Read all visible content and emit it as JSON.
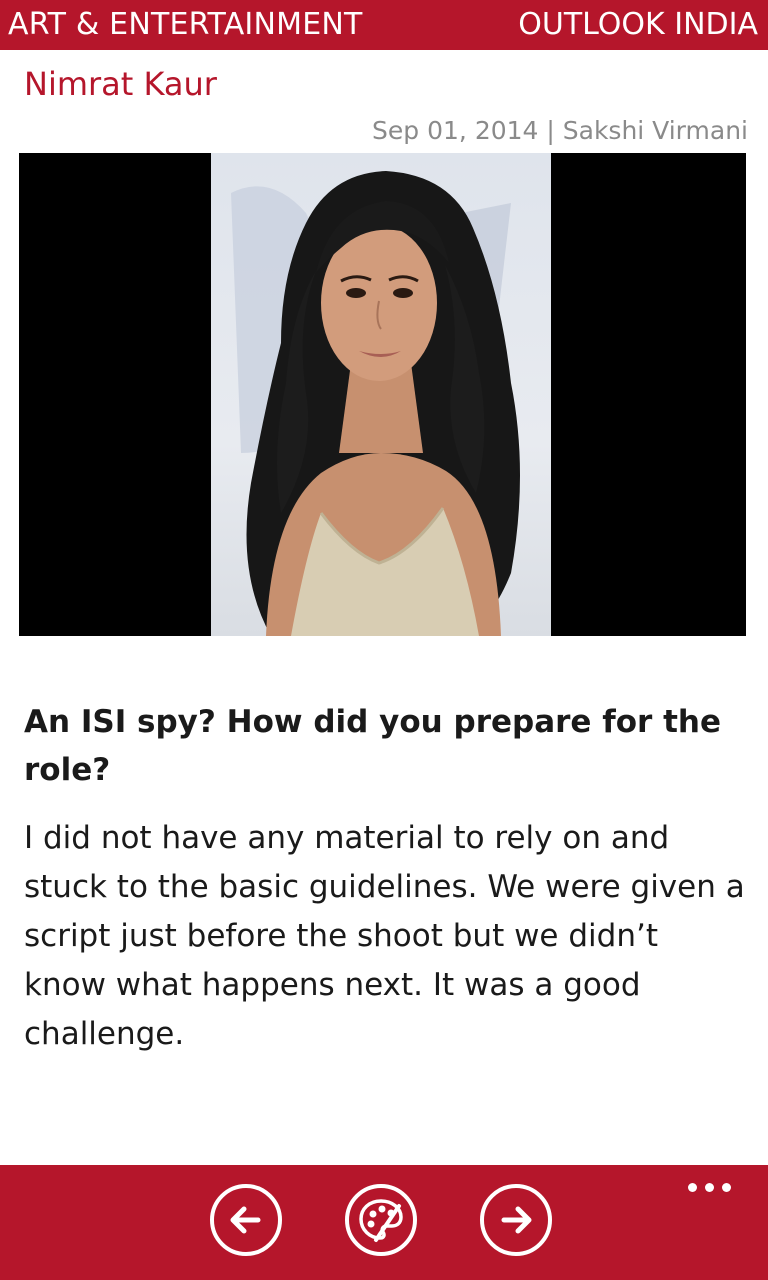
{
  "header": {
    "section": "ART & ENTERTAINMENT",
    "brand": "OUTLOOK INDIA"
  },
  "article": {
    "title": "Nimrat Kaur",
    "byline": "Sep 01, 2014 | Sakshi Virmani",
    "question": "An ISI spy? How did you prepare for the role?",
    "answer": "I did not have any material to rely on and stuck to the basic guidelines. We were given a script just before the shoot but we didn’t know what happens next. It was a good challenge."
  },
  "appbar": {
    "buttons": [
      {
        "name": "previous",
        "icon": "arrow-left-icon"
      },
      {
        "name": "theme",
        "icon": "palette-icon"
      },
      {
        "name": "next",
        "icon": "arrow-right-icon"
      }
    ],
    "more_icon": "more-dots-icon"
  },
  "colors": {
    "accent": "#b5162b",
    "byline": "#8a8a8a",
    "text": "#1a1a1a"
  }
}
